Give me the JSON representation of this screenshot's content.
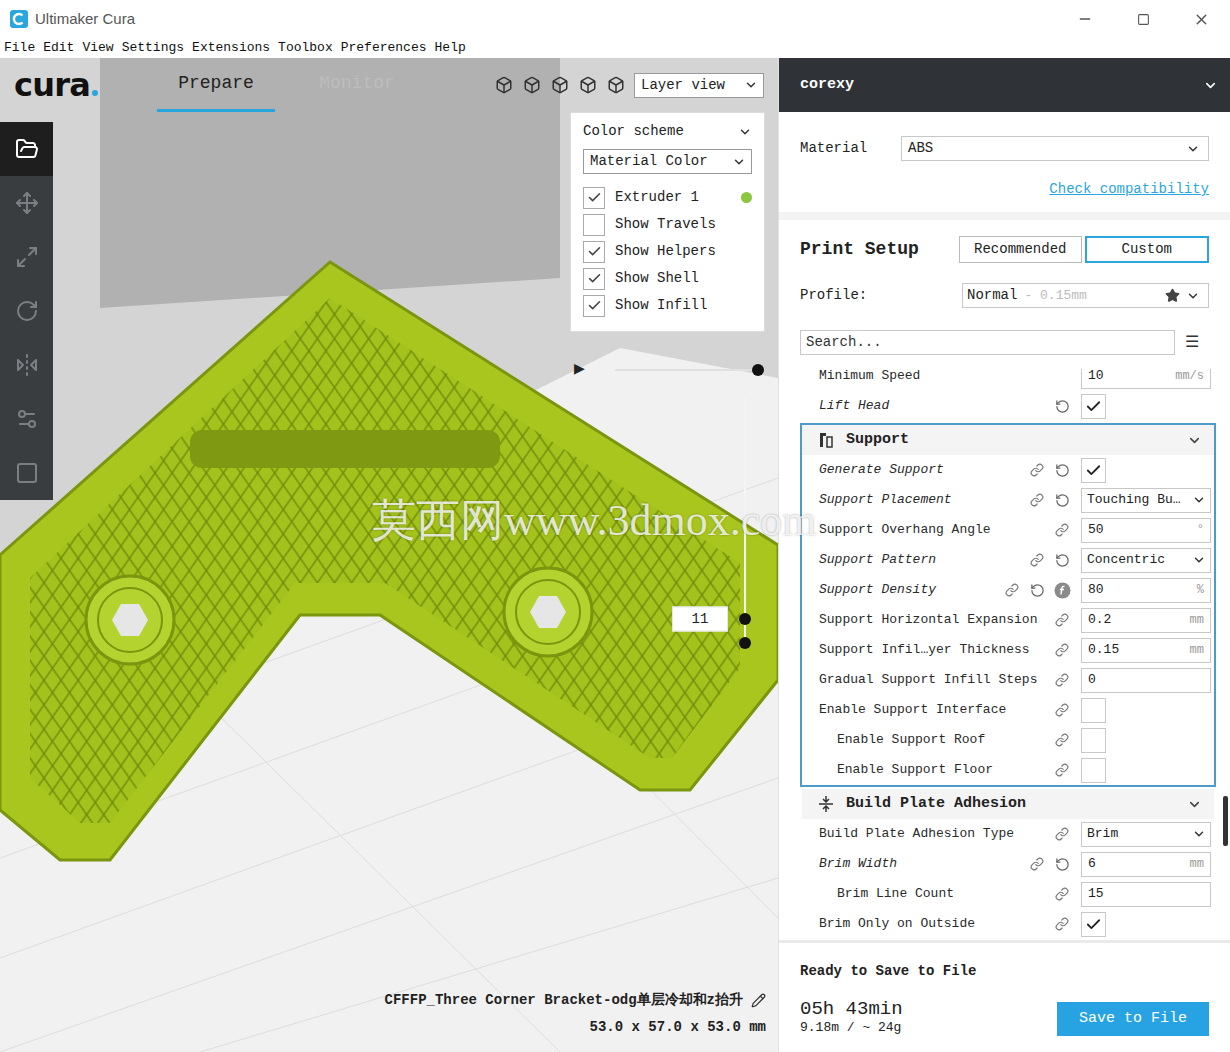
{
  "window": {
    "title": "Ultimaker Cura"
  },
  "menu": [
    "File",
    "Edit",
    "View",
    "Settings",
    "Extensions",
    "Toolbox",
    "Preferences",
    "Help"
  ],
  "header": {
    "logo": "cura",
    "tabs": [
      {
        "label": "Prepare",
        "selected": true
      },
      {
        "label": "Monitor",
        "selected": false
      }
    ],
    "view_mode": "Layer view"
  },
  "toolbar": [
    {
      "kind": "open",
      "selected": true
    },
    {
      "kind": "move",
      "selected": false
    },
    {
      "kind": "scale",
      "selected": false
    },
    {
      "kind": "rotate",
      "selected": false
    },
    {
      "kind": "mirror",
      "selected": false
    },
    {
      "kind": "settings",
      "selected": false
    },
    {
      "kind": "blocker",
      "selected": false
    }
  ],
  "color_panel": {
    "title": "Color scheme",
    "scheme": "Material Color",
    "options": [
      {
        "label": "Extruder 1",
        "checked": true,
        "color": "#8dc63f"
      },
      {
        "label": "Show Travels",
        "checked": false
      },
      {
        "label": "Show Helpers",
        "checked": true
      },
      {
        "label": "Show Shell",
        "checked": true
      },
      {
        "label": "Show Infill",
        "checked": true
      }
    ]
  },
  "layer_slider": {
    "play": "▶",
    "play_level": 1,
    "layer": "11",
    "level": 0.1
  },
  "watermark": "莫西网www.3dmox.com",
  "model": {
    "name": "CFFFP_Three Corner Bracket-odg单层冷却和z抬升",
    "dimensions": "53.0 x 57.0 x 53.0 mm"
  },
  "machine": {
    "name": "corexy"
  },
  "material": {
    "label": "Material",
    "value": "ABS",
    "link": "Check compatibility"
  },
  "print_setup": {
    "title": "Print Setup",
    "tabs": [
      {
        "label": "Recommended",
        "selected": false
      },
      {
        "label": "Custom",
        "selected": true
      }
    ],
    "profile_label": "Profile:",
    "profile": "Normal",
    "profile_detail": "- 0.15mm",
    "favorite": true,
    "search": {
      "placeholder": "Search..."
    },
    "menu_icon": "☰"
  },
  "settings": [
    {
      "highlighted": false,
      "expanded": true,
      "rows": [
        {
          "label": "Minimum Speed",
          "kind": "number",
          "value": "10",
          "unit": "mm/s",
          "modified": false,
          "linked": false,
          "resettable": false,
          "function": false,
          "indent": false
        },
        {
          "label": "Lift Head",
          "kind": "checkbox",
          "checked": true,
          "modified": true,
          "linked": false,
          "resettable": true,
          "function": false,
          "indent": false
        }
      ]
    },
    {
      "header": "Support",
      "icon": "support",
      "highlighted": true,
      "expanded": true,
      "rows": [
        {
          "label": "Generate Support",
          "kind": "checkbox",
          "checked": true,
          "modified": true,
          "linked": true,
          "resettable": true,
          "function": false,
          "indent": false
        },
        {
          "label": "Support Placement",
          "kind": "select",
          "value": "Touching Bu…",
          "modified": true,
          "linked": true,
          "resettable": true,
          "function": false,
          "indent": false
        },
        {
          "label": "Support Overhang Angle",
          "kind": "number",
          "value": "50",
          "unit": "°",
          "modified": false,
          "linked": true,
          "resettable": false,
          "function": false,
          "indent": false
        },
        {
          "label": "Support Pattern",
          "kind": "select",
          "value": "Concentric",
          "modified": true,
          "linked": true,
          "resettable": true,
          "function": false,
          "indent": false
        },
        {
          "label": "Support Density",
          "kind": "number",
          "value": "80",
          "unit": "%",
          "modified": true,
          "linked": true,
          "resettable": true,
          "function": true,
          "indent": false
        },
        {
          "label": "Support Horizontal Expansion",
          "kind": "number",
          "value": "0.2",
          "unit": "mm",
          "modified": false,
          "linked": true,
          "resettable": false,
          "function": false,
          "indent": false
        },
        {
          "label": "Support Infil…yer Thickness",
          "kind": "number",
          "value": "0.15",
          "unit": "mm",
          "modified": false,
          "linked": true,
          "resettable": false,
          "function": false,
          "indent": false
        },
        {
          "label": "Gradual Support Infill Steps",
          "kind": "number",
          "value": "0",
          "unit": "",
          "modified": false,
          "linked": true,
          "resettable": false,
          "function": false,
          "indent": false
        },
        {
          "label": "Enable Support Interface",
          "kind": "checkbox",
          "checked": false,
          "modified": false,
          "linked": true,
          "resettable": false,
          "function": false,
          "indent": false
        },
        {
          "label": "Enable Support Roof",
          "kind": "checkbox",
          "checked": false,
          "modified": false,
          "linked": true,
          "resettable": false,
          "function": false,
          "indent": true
        },
        {
          "label": "Enable Support Floor",
          "kind": "checkbox",
          "checked": false,
          "modified": false,
          "linked": true,
          "resettable": false,
          "function": false,
          "indent": true
        }
      ]
    },
    {
      "header": "Build Plate Adhesion",
      "icon": "adhesion",
      "highlighted": false,
      "expanded": true,
      "rows": [
        {
          "label": "Build Plate Adhesion Type",
          "kind": "select",
          "value": "Brim",
          "modified": false,
          "linked": true,
          "resettable": false,
          "function": false,
          "indent": false
        },
        {
          "label": "Brim Width",
          "kind": "number",
          "value": "6",
          "unit": "mm",
          "modified": true,
          "linked": true,
          "resettable": true,
          "function": false,
          "indent": false
        },
        {
          "label": "Brim Line Count",
          "kind": "number",
          "value": "15",
          "unit": "",
          "modified": false,
          "linked": true,
          "resettable": false,
          "function": false,
          "indent": true
        },
        {
          "label": "Brim Only on Outside",
          "kind": "checkbox",
          "checked": true,
          "modified": false,
          "linked": true,
          "resettable": false,
          "function": false,
          "indent": false
        }
      ]
    }
  ],
  "output": {
    "status": "Ready to Save to File",
    "time": "05h 43min",
    "usage": "9.18m / ~ 24g",
    "button": "Save to File"
  }
}
